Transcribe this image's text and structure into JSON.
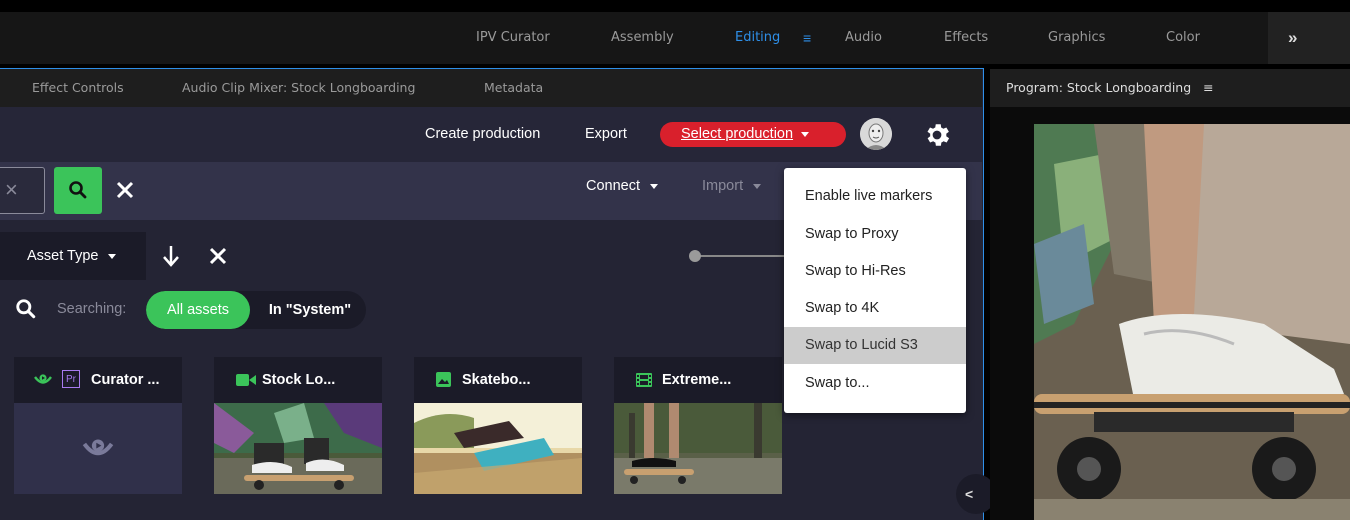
{
  "workspaces": {
    "items": [
      "IPV Curator",
      "Assembly",
      "Editing",
      "Audio",
      "Effects",
      "Graphics",
      "Color"
    ],
    "active": "Editing",
    "overflow_icon": "»",
    "menu_icon": "≡"
  },
  "panel_tabs": [
    "Effect Controls",
    "Audio Clip Mixer: Stock Longboarding",
    "Metadata"
  ],
  "header": {
    "create_production": "Create production",
    "export": "Export",
    "select_production": "Select production"
  },
  "search": {
    "connect": "Connect",
    "import": "Import"
  },
  "filters": {
    "asset_type": "Asset Type",
    "searching_label": "Searching:",
    "scope_all": "All assets",
    "scope_system": "In \"System\""
  },
  "assets": [
    {
      "title": "Curator ...",
      "icon": "curator-icon",
      "badge": "Pr"
    },
    {
      "title": "Stock Lo...",
      "icon": "video-camera-icon"
    },
    {
      "title": "Skatebo...",
      "icon": "image-icon"
    },
    {
      "title": "Extreme...",
      "icon": "film-icon"
    }
  ],
  "menu": {
    "items": [
      "Enable live markers",
      "Swap to Proxy",
      "Swap to Hi-Res",
      "Swap to 4K",
      "Swap to Lucid S3",
      "Swap to..."
    ],
    "highlighted": "Swap to Lucid S3"
  },
  "program": {
    "title": "Program: Stock Longboarding",
    "menu_icon": "≡"
  },
  "colors": {
    "accent_blue": "#2e8fe8",
    "accent_green": "#3bc45a",
    "accent_red": "#d9202c",
    "panel_bg": "#242434"
  }
}
